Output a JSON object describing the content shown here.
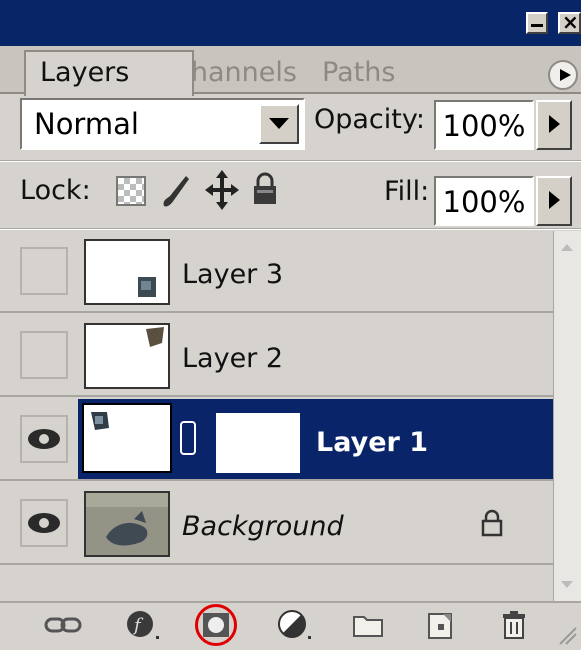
{
  "tabs": [
    {
      "label": "Layers",
      "active": true
    },
    {
      "label": "Channels",
      "active": false
    },
    {
      "label": "Paths",
      "active": false
    }
  ],
  "blend_mode": "Normal",
  "opacity": {
    "label": "Opacity:",
    "value": "100%"
  },
  "lock": {
    "label": "Lock:"
  },
  "fill": {
    "label": "Fill:",
    "value": "100%"
  },
  "layers": [
    {
      "name": "Layer 3",
      "visible": false,
      "selected": false
    },
    {
      "name": "Layer 2",
      "visible": false,
      "selected": false
    },
    {
      "name": "Layer 1",
      "visible": true,
      "selected": true,
      "has_mask": true
    },
    {
      "name": "Background",
      "visible": true,
      "selected": false,
      "locked": true
    }
  ],
  "toolbar": {
    "icons": [
      "link-layers-icon",
      "layer-style-icon",
      "add-mask-icon",
      "adjustment-layer-icon",
      "new-group-icon",
      "new-layer-icon",
      "delete-layer-icon"
    ],
    "highlighted": "add-mask-icon"
  },
  "colors": {
    "selection": "#0a246a",
    "titlebar": "#082567",
    "highlight_ring": "#e00000"
  }
}
